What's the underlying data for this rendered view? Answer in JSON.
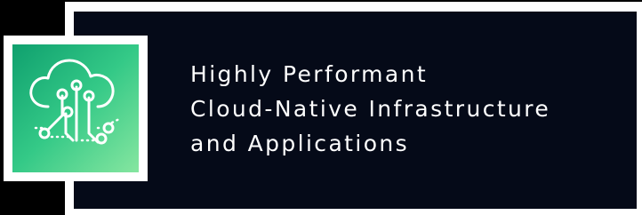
{
  "headline": {
    "line1": "Highly Performant",
    "line2": "Cloud-Native Infrastructure",
    "line3": "and Applications"
  },
  "icon": "cloud-circuit-icon",
  "colors": {
    "background": "#000000",
    "card": "#050a18",
    "frame": "#ffffff",
    "tile_gradient_start": "#0fa06e",
    "tile_gradient_end": "#86e6a0",
    "text": "#ffffff"
  }
}
